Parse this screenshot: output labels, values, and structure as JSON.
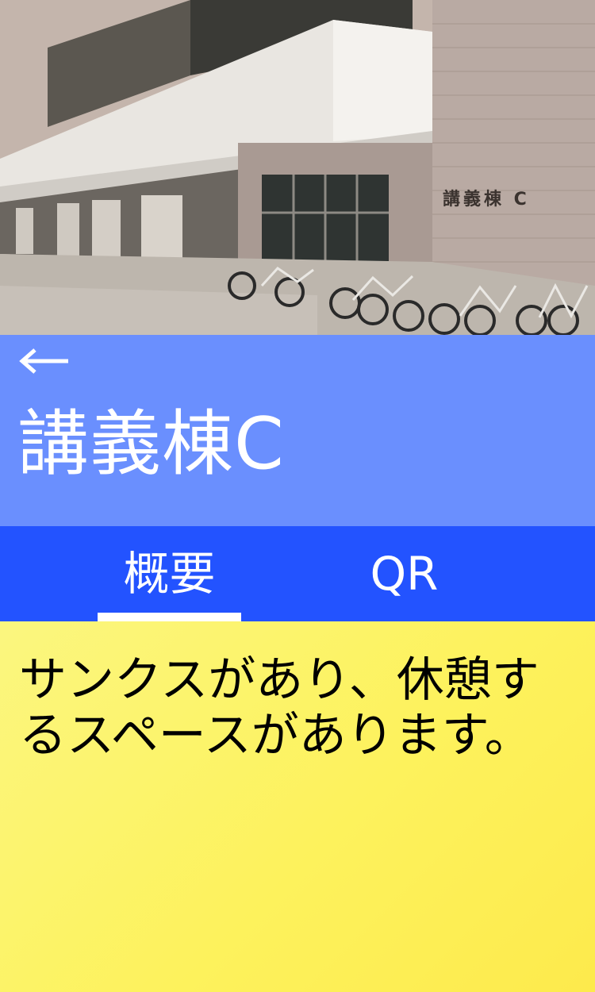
{
  "building_photo": {
    "sign_text": "講義棟 C"
  },
  "header": {
    "back_icon": "arrow-left-icon",
    "title": "講義棟C",
    "background_color": "#6a8ffe"
  },
  "tabs": {
    "background_color": "#2353ff",
    "selected": "概要",
    "items": [
      {
        "label": "概要"
      },
      {
        "label": "QR"
      }
    ]
  },
  "content": {
    "description": "サンクスがあり、休憩するスペースがあります。"
  }
}
